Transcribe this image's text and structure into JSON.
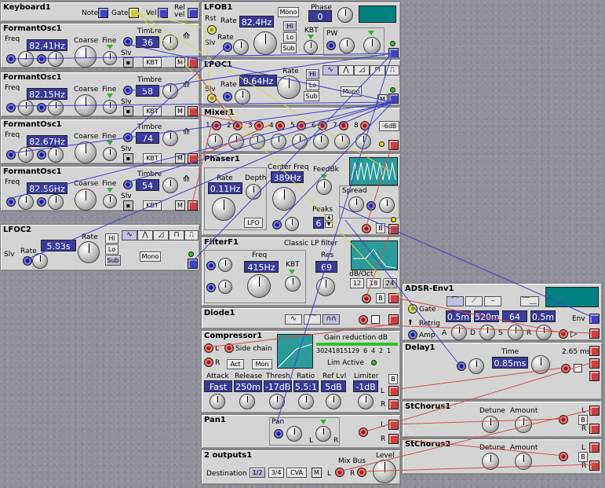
{
  "keyboard": {
    "title": "Keyboard1",
    "note": "Note",
    "gate": "Gate",
    "vel": "Vel",
    "relvel": "Rel vel"
  },
  "formant": [
    {
      "title": "FormantOsc1",
      "freq": "82.41Hz",
      "timbre": "36"
    },
    {
      "title": "FormantOsc1",
      "freq": "82.15Hz",
      "timbre": "58"
    },
    {
      "title": "FormantOsc1",
      "freq": "82.67Hz",
      "timbre": "74"
    },
    {
      "title": "FormantOsc1",
      "freq": "82.56Hz",
      "timbre": "54"
    }
  ],
  "formant_labels": {
    "freq": "Freq",
    "coarse": "Coarse",
    "fine": "Fine",
    "timbre": "Timbre",
    "slv": "Slv",
    "kbt": "KBT",
    "m": "M"
  },
  "lfoc2": {
    "title": "LFOC2",
    "rate_label": "Rate",
    "rate": "5.83s",
    "slv": "Slv",
    "hi": "Hi",
    "lo": "Lo",
    "sub": "Sub",
    "mono": "Mono"
  },
  "lfob1": {
    "title": "LFOB1",
    "rst": "Rst",
    "rate_label": "Rate",
    "rate": "82.4Hz",
    "slv": "Slv",
    "mono": "Mono",
    "phase_label": "Phase",
    "phase": "0",
    "hi": "Hi",
    "lo": "Lo",
    "sub": "Sub",
    "kbt": "KBT",
    "pw": "PW"
  },
  "lfoc1": {
    "title": "LFOC1",
    "rate_label": "Rate",
    "rate": "0.64Hz",
    "slv": "Slv",
    "hi": "Hi",
    "lo": "Lo",
    "sub": "Sub",
    "mono": "Mono",
    "m": "M"
  },
  "mixer": {
    "title": "Mixer1",
    "channels": [
      "1",
      "2",
      "3",
      "4",
      "5",
      "6",
      "7",
      "8"
    ],
    "db": "-6dB"
  },
  "phaser": {
    "title": "Phaser1",
    "rate_label": "Rate",
    "rate": "0.11Hz",
    "depth": "Depth",
    "center_label": "Center Freq",
    "center": "389Hz",
    "feedbk": "FeedBk",
    "spread": "Spread",
    "peaks_label": "Peaks",
    "peaks": "6",
    "lfo": "LFO",
    "b": "B"
  },
  "filter": {
    "title": "FilterF1",
    "type": "Classic LP filter",
    "freq_label": "Freq",
    "freq": "415Hz",
    "kbt": "KBT",
    "res_label": "Res",
    "res": "69",
    "dboct": "dB/Oct",
    "slopes": [
      "12",
      "18",
      "24"
    ],
    "b": "B"
  },
  "diode": {
    "title": "Diode1"
  },
  "compressor": {
    "title": "Compressor1",
    "l": "L",
    "r": "R",
    "sidechain": "Side chain",
    "act": "Act",
    "mon": "Mon",
    "gain_red": "Gain reduction dB",
    "scale": [
      "30",
      "24",
      "18",
      "15",
      "12",
      "9",
      "6",
      "4",
      "2",
      "1"
    ],
    "lim_active": "Lim Active",
    "attack_label": "Attack",
    "attack": "Fast",
    "release_label": "Release",
    "release": "250m",
    "thresh_label": "Thresh.",
    "thresh": "-17dB",
    "ratio_label": "Ratio",
    "ratio": "5.5:1",
    "reflvl_label": "Ref Lvl",
    "reflvl": "5dB",
    "limiter_label": "Limiter",
    "limiter": "-1dB",
    "b": "B"
  },
  "pan": {
    "title": "Pan1",
    "pan": "Pan",
    "l": "L",
    "r": "R"
  },
  "outputs": {
    "title": "2 outputs1",
    "dest": "Destination",
    "d1": "1/2",
    "d2": "3/4",
    "cva": "CVA",
    "m": "M",
    "mixbus": "Mix Bus",
    "l": "L",
    "r": "R",
    "level": "Level"
  },
  "adsr": {
    "title": "ADSR-Env1",
    "gate": "Gate",
    "retrig": "Retrig",
    "amp": "Amp",
    "a": "0.5m",
    "d": "520m",
    "s": "64",
    "r": "0.5m",
    "al": "A",
    "dl": "D",
    "sl": "S",
    "rl": "R",
    "env": "Env"
  },
  "delay": {
    "title": "Delay1",
    "time_label": "Time",
    "time": "0.85ms",
    "max": "2.65 ms"
  },
  "chorus1": {
    "title": "StChorus1",
    "detune": "Detune",
    "amount": "Amount",
    "l": "L",
    "r": "R",
    "b": "B"
  },
  "chorus2": {
    "title": "StChorus2",
    "detune": "Detune",
    "amount": "Amount",
    "l": "L",
    "r": "R",
    "b": "B"
  },
  "colors": {
    "display": "#3a3a9a",
    "teal": "#008080",
    "panel": "#d4d4d4"
  }
}
